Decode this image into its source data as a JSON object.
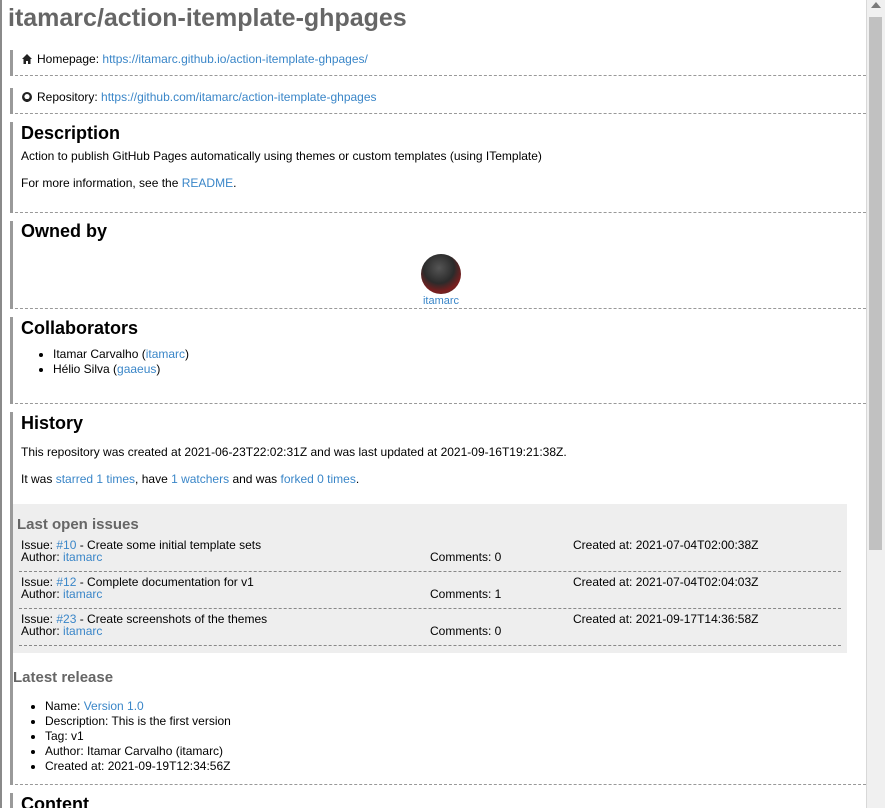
{
  "repo": {
    "title": "itamarc/action-itemplate-ghpages"
  },
  "homepage": {
    "label": "Homepage:",
    "url": "https://itamarc.github.io/action-itemplate-ghpages/"
  },
  "repository": {
    "label": "Repository:",
    "url": "https://github.com/itamarc/action-itemplate-ghpages"
  },
  "description": {
    "heading": "Description",
    "text": "Action to publish GitHub Pages automatically using themes or custom templates (using ITemplate)",
    "more_prefix": "For more information, see the ",
    "more_link": "README",
    "more_suffix": "."
  },
  "owner": {
    "heading": "Owned by",
    "login": "itamarc"
  },
  "collaborators": {
    "heading": "Collaborators",
    "items": [
      {
        "name": "Itamar Carvalho (",
        "login": "itamarc",
        "close": ")"
      },
      {
        "name": "Hélio Silva (",
        "login": "gaaeus",
        "close": ")"
      }
    ]
  },
  "history": {
    "heading": "History",
    "created_text": "This repository was created at 2021-06-23T22:02:31Z and was last updated at 2021-09-16T19:21:38Z.",
    "stats_prefix": "It was ",
    "starred": "starred 1 times",
    "stats_mid1": ", have ",
    "watchers": "1 watchers",
    "stats_mid2": " and was ",
    "forked": "forked 0 times",
    "stats_suffix": "."
  },
  "issues": {
    "heading": "Last open issues",
    "issue_label": "Issue: ",
    "author_label": "Author: ",
    "items": [
      {
        "number": "#10",
        "title": " - Create some initial template sets",
        "author": "itamarc",
        "comments": "Comments: 0",
        "created": "Created at: 2021-07-04T02:00:38Z"
      },
      {
        "number": "#12",
        "title": " - Complete documentation for v1",
        "author": "itamarc",
        "comments": "Comments: 1",
        "created": "Created at: 2021-07-04T02:04:03Z"
      },
      {
        "number": "#23",
        "title": " - Create screenshots of the themes",
        "author": "itamarc",
        "comments": "Comments: 0",
        "created": "Created at: 2021-09-17T14:36:58Z"
      }
    ]
  },
  "release": {
    "heading": "Latest release",
    "name_label": "Name: ",
    "name": "Version 1.0",
    "description": "Description: This is the first version",
    "tag": "Tag: v1",
    "author": "Author: Itamar Carvalho (itamarc)",
    "created": "Created at: 2021-09-19T12:34:56Z"
  },
  "content": {
    "heading": "Content"
  },
  "icons": {
    "homepage": "home-icon",
    "repository": "github-icon"
  },
  "colors": {
    "link": "#3a86c8",
    "title": "#666666",
    "box": "#eeeeee"
  }
}
